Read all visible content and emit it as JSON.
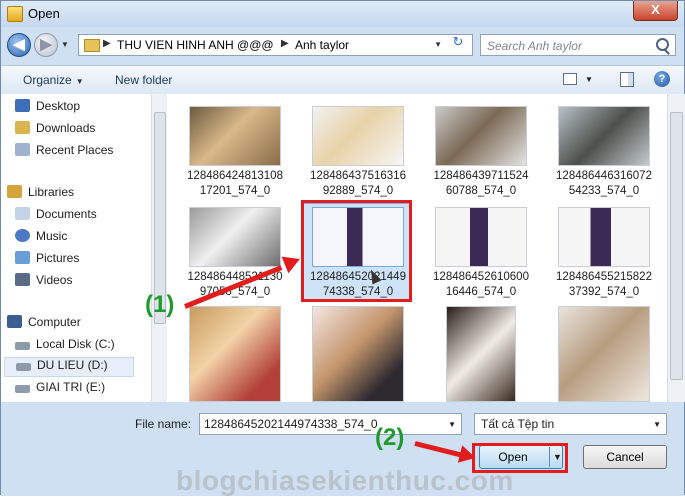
{
  "window": {
    "title": "Open",
    "close_glyph": "X"
  },
  "nav": {
    "back_glyph": "◀",
    "forward_glyph": "▶",
    "breadcrumb": [
      "THU VIEN HINH ANH @@@",
      "Anh taylor"
    ],
    "search_placeholder": "Search Anh taylor"
  },
  "toolbar": {
    "organize_label": "Organize",
    "new_folder_label": "New folder"
  },
  "sidebar": {
    "items": [
      {
        "label": "Desktop",
        "icon": "desktop-icon"
      },
      {
        "label": "Downloads",
        "icon": "downloads-icon"
      },
      {
        "label": "Recent Places",
        "icon": "recent-places-icon"
      },
      {
        "label": "Libraries",
        "icon": "libraries-icon"
      },
      {
        "label": "Documents",
        "icon": "documents-icon"
      },
      {
        "label": "Music",
        "icon": "music-icon"
      },
      {
        "label": "Pictures",
        "icon": "pictures-icon"
      },
      {
        "label": "Videos",
        "icon": "videos-icon"
      },
      {
        "label": "Computer",
        "icon": "computer-icon"
      },
      {
        "label": "Local Disk (C:)",
        "icon": "drive-icon"
      },
      {
        "label": "DU LIEU (D:)",
        "icon": "drive-icon"
      },
      {
        "label": "GIAI TRI (E:)",
        "icon": "drive-icon"
      }
    ]
  },
  "files": [
    {
      "name": "12848642481310817201_574_0",
      "line1": "128486424813108",
      "line2": "17201_574_0"
    },
    {
      "name": "12848643751631692889_574_0",
      "line1": "128486437516316",
      "line2": "92889_574_0"
    },
    {
      "name": "12848643971152460788_574_0",
      "line1": "128486439711524",
      "line2": "60788_574_0"
    },
    {
      "name": "12848644631607254233_574_0",
      "line1": "128486446316072",
      "line2": "54233_574_0"
    },
    {
      "name": "12848644852113097058_574_0",
      "line1": "128486448521130",
      "line2": "97058_574_0"
    },
    {
      "name": "12848645202144974338_574_0",
      "line1": "128486452021449",
      "line2": "74338_574_0"
    },
    {
      "name": "12848645261060016446_574_0",
      "line1": "128486452610600",
      "line2": "16446_574_0"
    },
    {
      "name": "12848645521582237392_574_0",
      "line1": "128486455215822",
      "line2": "37392_574_0"
    },
    {
      "name": "",
      "line1": "",
      "line2": ""
    },
    {
      "name": "",
      "line1": "",
      "line2": ""
    },
    {
      "name": "",
      "line1": "",
      "line2": ""
    },
    {
      "name": "",
      "line1": "",
      "line2": ""
    }
  ],
  "footer": {
    "file_name_label": "File name:",
    "file_name_value": "12848645202144974338_574_0",
    "file_type_value": "Tất cả Tệp tin",
    "open_label": "Open",
    "cancel_label": "Cancel"
  },
  "annotations": {
    "step1": "(1)",
    "step2": "(2)"
  },
  "watermark": "blogchiasekienthuc.com",
  "colors": {
    "highlight": "#e31d1d",
    "annotation": "#1f9a2c",
    "selection": "#cfe3f8"
  }
}
